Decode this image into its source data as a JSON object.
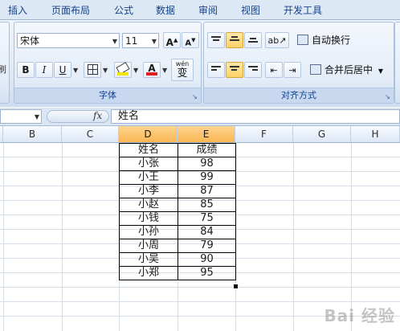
{
  "menu": [
    "插入",
    "页面布局",
    "公式",
    "数据",
    "审阅",
    "视图",
    "开发工具"
  ],
  "font_group": {
    "font_name": "宋体",
    "font_size": "11",
    "grow_label": "A",
    "shrink_label": "A",
    "bold": "B",
    "italic": "I",
    "underline": "U",
    "font_color_label": "A",
    "phonetic_top": "wén",
    "phonetic_main": "变",
    "label": "字体"
  },
  "alignment_group": {
    "wrap_text": "自动换行",
    "merge_center": "合并后居中",
    "label": "对齐方式"
  },
  "formula_bar": {
    "fx": "fx",
    "content": "姓名"
  },
  "columns": [
    "B",
    "C",
    "D",
    "E",
    "F",
    "G",
    "H"
  ],
  "selected_columns": [
    "D",
    "E"
  ],
  "table": {
    "headers": [
      "姓名",
      "成绩"
    ],
    "rows": [
      [
        "小张",
        "98"
      ],
      [
        "小王",
        "99"
      ],
      [
        "小李",
        "87"
      ],
      [
        "小赵",
        "85"
      ],
      [
        "小钱",
        "75"
      ],
      [
        "小孙",
        "84"
      ],
      [
        "小周",
        "79"
      ],
      [
        "小吴",
        "90"
      ],
      [
        "小郑",
        "95"
      ]
    ]
  },
  "watermark": "Bai 经验"
}
